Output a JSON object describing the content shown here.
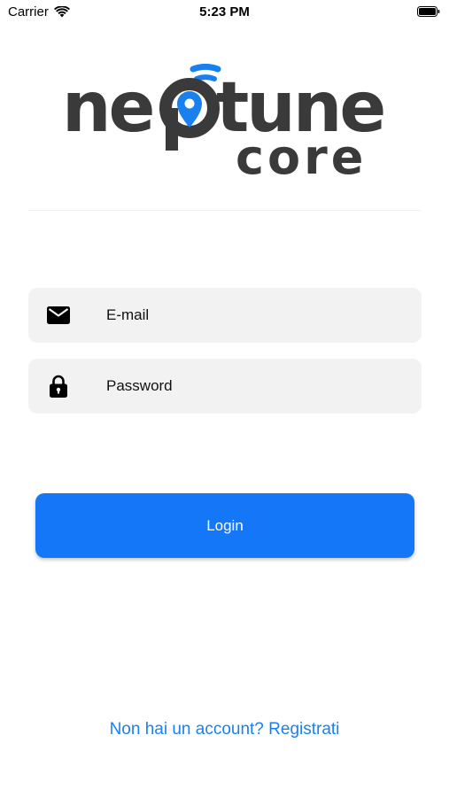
{
  "status_bar": {
    "carrier": "Carrier",
    "time": "5:23 PM",
    "wifi_icon": "wifi-icon",
    "battery_icon": "battery-icon"
  },
  "logo": {
    "word1_part1": "ne",
    "word1_part2": "tune",
    "word2": "core",
    "accent_color": "#1a80f0",
    "text_color": "#3a3a3a"
  },
  "form": {
    "email": {
      "placeholder": "E-mail",
      "value": "",
      "icon": "mail-icon"
    },
    "password": {
      "placeholder": "Password",
      "value": "",
      "icon": "lock-icon"
    },
    "login_label": "Login",
    "login_color": "#1377f8"
  },
  "footer": {
    "register_text": "Non hai un account? Registrati"
  }
}
